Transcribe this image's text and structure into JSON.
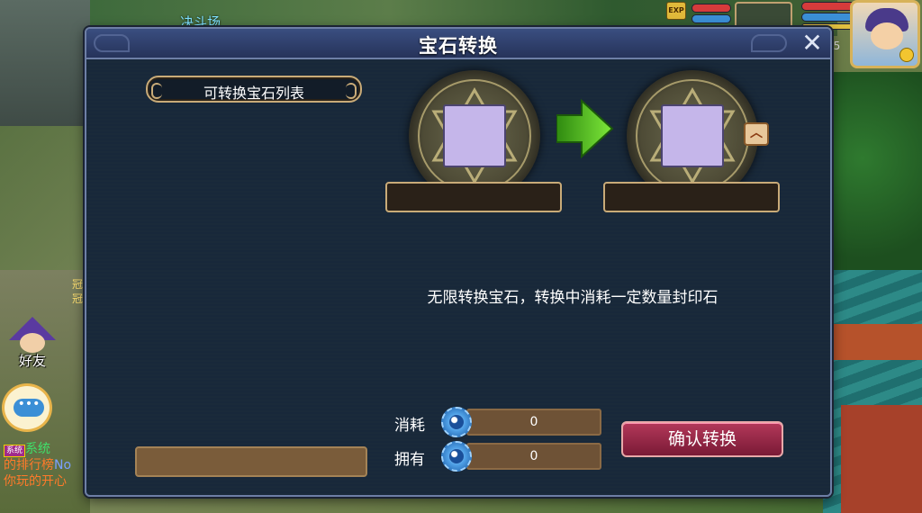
{
  "scene": {
    "location_label": "决斗场",
    "side_fragment": "冠\n冠"
  },
  "hud": {
    "exp_icon": "EXP",
    "level": "55"
  },
  "left_hud": {
    "friend_label": "好友",
    "chat_icon": "•••",
    "chat_tag": "系统",
    "chat_system": "系统",
    "chat_line1": "的排行榜",
    "chat_line1_suffix": "No",
    "chat_line2": "你玩的开心"
  },
  "dialog": {
    "title": "宝石转换",
    "close_icon": "✕",
    "list_header": "可转换宝石列表",
    "source_name": "",
    "target_name": "",
    "expand_icon": "︿",
    "description": "无限转换宝石，转换中消耗一定数量封印石",
    "consume_label": "消耗",
    "consume_value": "0",
    "own_label": "拥有",
    "own_value": "0",
    "confirm_label": "确认转换"
  },
  "colors": {
    "dialog_bg": "#1a2a3a",
    "border_gold": "#c9ab78",
    "gem_slot": "#c5b6ea",
    "confirm_btn": "#9e2a48",
    "arrow_green": "#4ec21e"
  }
}
